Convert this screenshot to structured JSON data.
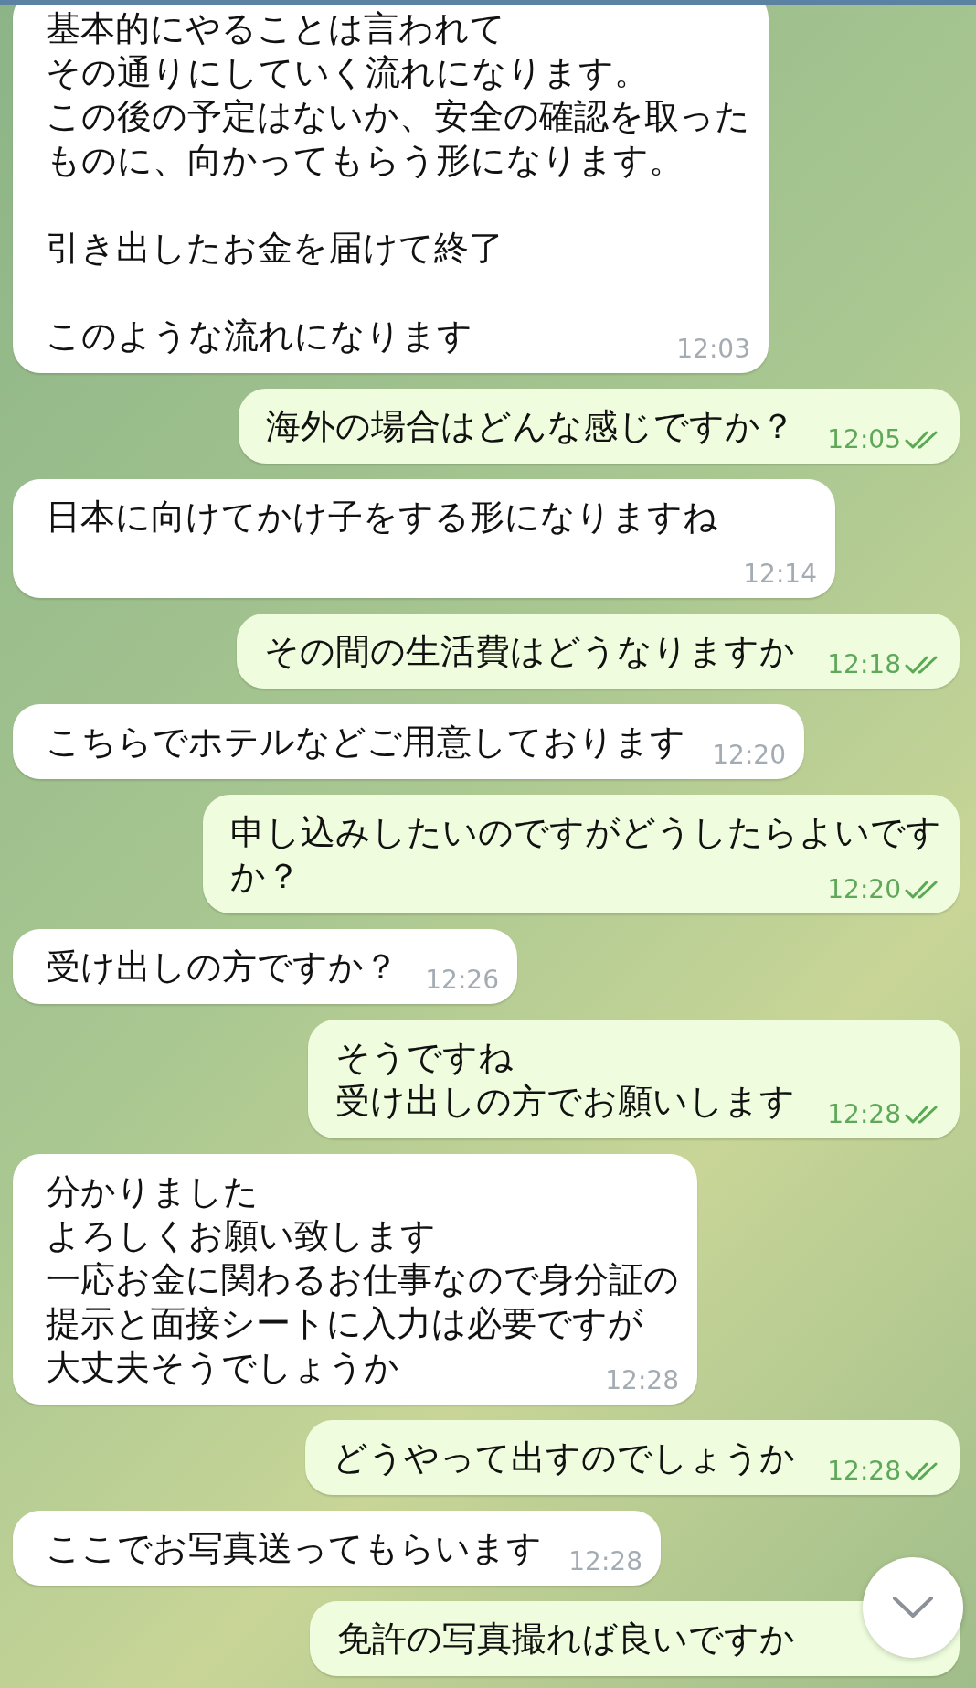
{
  "messages": [
    {
      "kind": "incoming",
      "paragraphs": [
        [
          "基本的にやることは言われて",
          "その通りにしていく流れになります。",
          "この後の予定はないか、安全の確認を取った",
          "ものに、向かってもらう形になります。"
        ],
        [
          "引き出したお金を届けて終了"
        ],
        [
          "このような流れになります"
        ]
      ],
      "time": "12:03"
    },
    {
      "kind": "outgoing",
      "paragraphs": [
        [
          "海外の場合はどんな感じですか？"
        ]
      ],
      "time": "12:05",
      "read": true
    },
    {
      "kind": "incoming",
      "paragraphs": [
        [
          "日本に向けてかけ子をする形になりますね"
        ]
      ],
      "time": "12:14"
    },
    {
      "kind": "outgoing",
      "paragraphs": [
        [
          "その間の生活費はどうなりますか"
        ]
      ],
      "time": "12:18",
      "read": true
    },
    {
      "kind": "incoming",
      "paragraphs": [
        [
          "こちらでホテルなどご用意しております"
        ]
      ],
      "time": "12:20"
    },
    {
      "kind": "outgoing",
      "paragraphs": [
        [
          "申し込みしたいのですがどうしたらよいです",
          "か？"
        ]
      ],
      "time": "12:20",
      "read": true
    },
    {
      "kind": "incoming",
      "paragraphs": [
        [
          "受け出しの方ですか？"
        ]
      ],
      "time": "12:26"
    },
    {
      "kind": "outgoing",
      "paragraphs": [
        [
          "そうですね",
          "受け出しの方でお願いします"
        ]
      ],
      "time": "12:28",
      "read": true
    },
    {
      "kind": "incoming",
      "paragraphs": [
        [
          "分かりました",
          "よろしくお願い致します",
          "一応お金に関わるお仕事なので身分証の",
          "提示と面接シートに入力は必要ですが",
          "大丈夫そうでしょうか"
        ]
      ],
      "time": "12:28"
    },
    {
      "kind": "outgoing",
      "paragraphs": [
        [
          "どうやって出すのでしょうか"
        ]
      ],
      "time": "12:28",
      "read": true
    },
    {
      "kind": "incoming",
      "paragraphs": [
        [
          "ここでお写真送ってもらいます"
        ]
      ],
      "time": "12:28"
    },
    {
      "kind": "outgoing",
      "paragraphs": [
        [
          "免許の写真撮れば良いですか"
        ]
      ]
    }
  ]
}
